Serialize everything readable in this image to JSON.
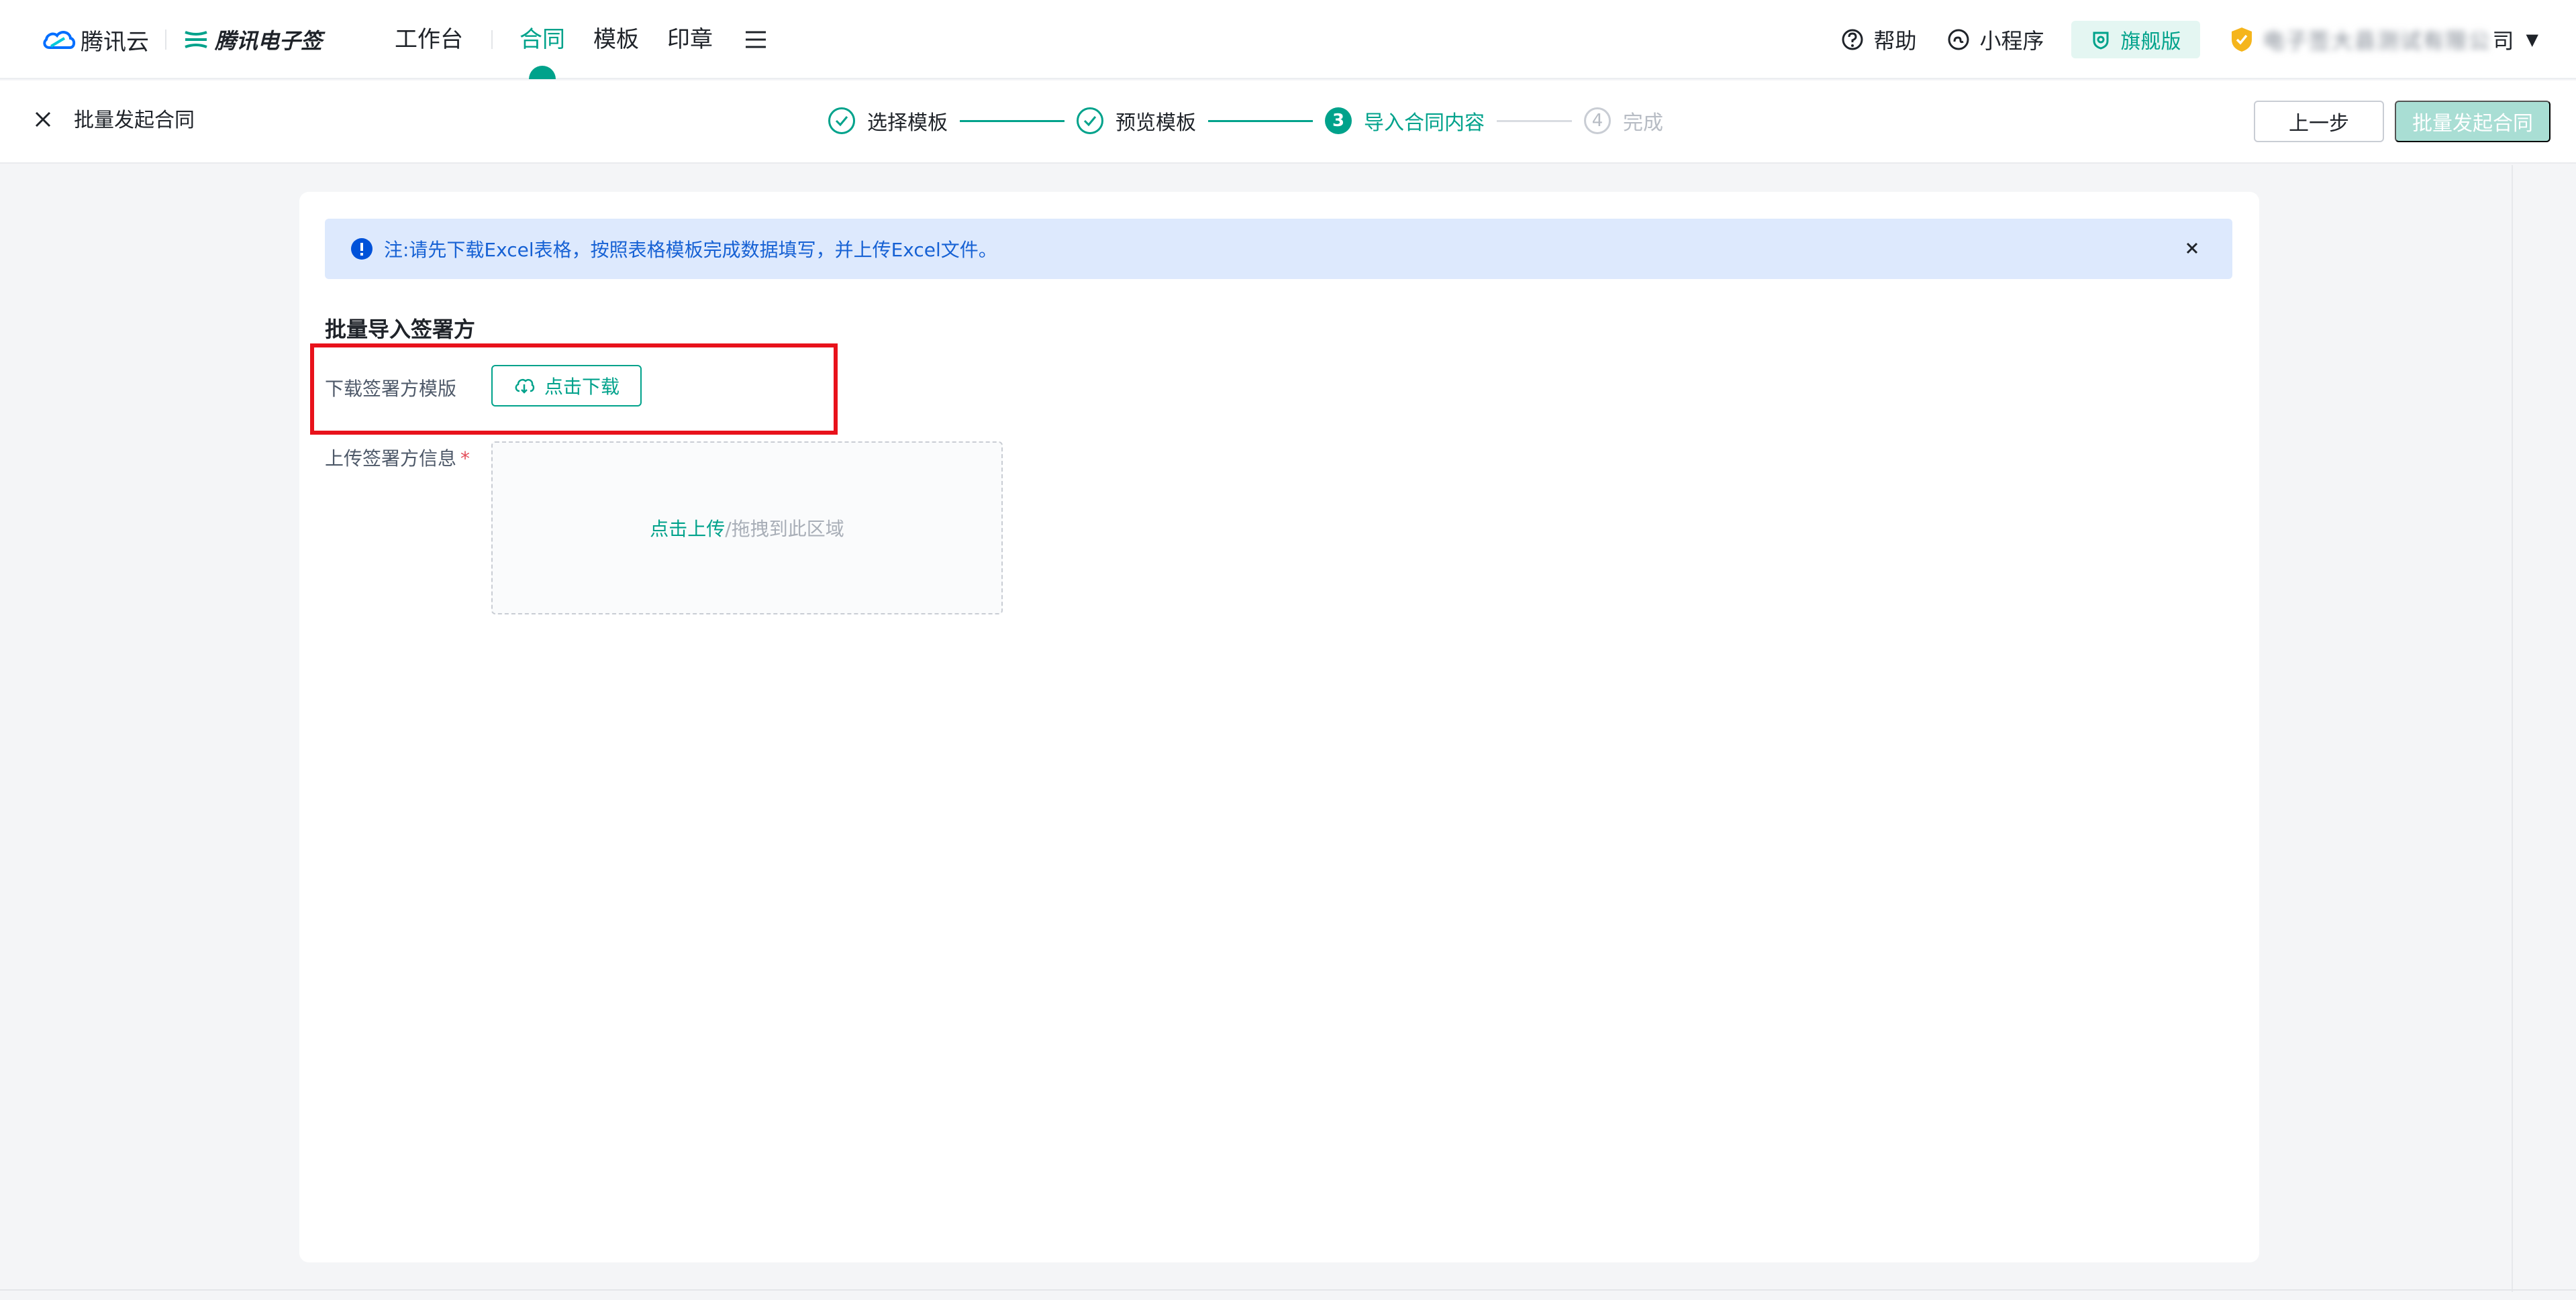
{
  "brand": {
    "tencent_cloud": "腾讯云",
    "esign": "腾讯电子签"
  },
  "nav": {
    "items": [
      "工作台",
      "合同",
      "模板",
      "印章"
    ],
    "active_index": 1
  },
  "toolbar": {
    "help": "帮助",
    "mini_program": "小程序",
    "tier": "旗舰版",
    "company_blurred": "电子签大县测试有限公",
    "company_tail": "司"
  },
  "stepbar": {
    "title": "批量发起合同",
    "steps": [
      {
        "index": "1",
        "label": "选择模板",
        "state": "done"
      },
      {
        "index": "2",
        "label": "预览模板",
        "state": "done"
      },
      {
        "index": "3",
        "label": "导入合同内容",
        "state": "current"
      },
      {
        "index": "4",
        "label": "完成",
        "state": "todo"
      }
    ],
    "prev_label": "上一步",
    "submit_label": "批量发起合同"
  },
  "content": {
    "notice": "注:请先下载Excel表格，按照表格模板完成数据填写，并上传Excel文件。",
    "section_title": "批量导入签署方",
    "download_label": "下载签署方模版",
    "download_button": "点击下载",
    "upload_label": "上传签署方信息",
    "required_mark": "*",
    "upload_link": "点击上传",
    "upload_hint": "/拖拽到此区域"
  },
  "colors": {
    "accent": "#00a28b",
    "notice_bg": "#dde9fd",
    "notice_text": "#1661d4",
    "highlight": "#e8121b"
  }
}
